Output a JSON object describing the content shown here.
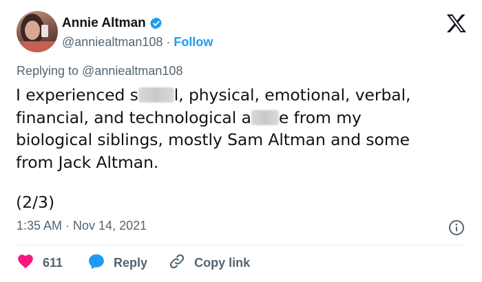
{
  "author": {
    "name": "Annie Altman",
    "handle": "@anniealtman108",
    "separator": "·",
    "follow_label": "Follow",
    "verified": true
  },
  "icons": {
    "verified": "verified-badge-icon",
    "brand": "x-logo-icon",
    "info": "info-icon",
    "like": "heart-icon",
    "reply": "speech-bubble-icon",
    "copy": "link-icon"
  },
  "colors": {
    "accent": "#1d9bf0",
    "like": "#f91880",
    "text": "#0f1419",
    "muted": "#536471"
  },
  "reply_context": {
    "prefix": "Replying to",
    "mention": "@anniealtman108"
  },
  "tweet": {
    "line1_a": "I experienced s",
    "line1_b": "l, physical, emotional, verbal,",
    "line2_a": "financial, and technological a",
    "line2_b": "e from my",
    "line3": "biological siblings, mostly Sam Altman and some",
    "line4": "from Jack Altman.",
    "page": "(2/3)"
  },
  "meta": {
    "timestamp": "1:35 AM · Nov 14, 2021"
  },
  "actions": {
    "like_count": "611",
    "reply_label": "Reply",
    "copy_label": "Copy link"
  }
}
